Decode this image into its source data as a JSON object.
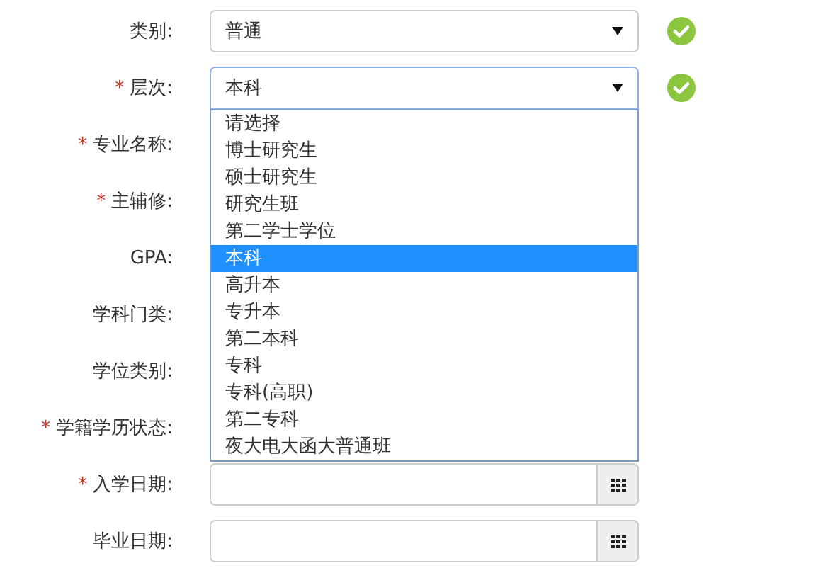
{
  "fields": [
    {
      "label": "类别:",
      "kind": "select",
      "value": "普通",
      "valid": true,
      "focused": false
    },
    {
      "label": "层次:",
      "required_mark": "*",
      "kind": "select",
      "value": "本科",
      "valid": true,
      "focused": true,
      "open": true,
      "options": [
        {
          "label": "请选择",
          "selected": false
        },
        {
          "label": "博士研究生",
          "selected": false
        },
        {
          "label": "硕士研究生",
          "selected": false
        },
        {
          "label": "研究生班",
          "selected": false
        },
        {
          "label": "第二学士学位",
          "selected": false
        },
        {
          "label": "本科",
          "selected": true
        },
        {
          "label": "高升本",
          "selected": false
        },
        {
          "label": "专升本",
          "selected": false
        },
        {
          "label": "第二本科",
          "selected": false
        },
        {
          "label": "专科",
          "selected": false
        },
        {
          "label": "专科(高职)",
          "selected": false
        },
        {
          "label": "第二专科",
          "selected": false
        },
        {
          "label": "夜大电大函大普通班",
          "selected": false
        }
      ]
    },
    {
      "label": "专业名称:",
      "required_mark": "*",
      "kind": "covered"
    },
    {
      "label": "主辅修:",
      "required_mark": "*",
      "kind": "covered"
    },
    {
      "label": "GPA:",
      "kind": "covered"
    },
    {
      "label": "学科门类:",
      "kind": "covered"
    },
    {
      "label": "学位类别:",
      "kind": "covered"
    },
    {
      "label": "学籍学历状态:",
      "required_mark": "*",
      "kind": "covered"
    },
    {
      "label": "入学日期:",
      "required_mark": "*",
      "kind": "date"
    },
    {
      "label": "毕业日期:",
      "kind": "date"
    }
  ]
}
